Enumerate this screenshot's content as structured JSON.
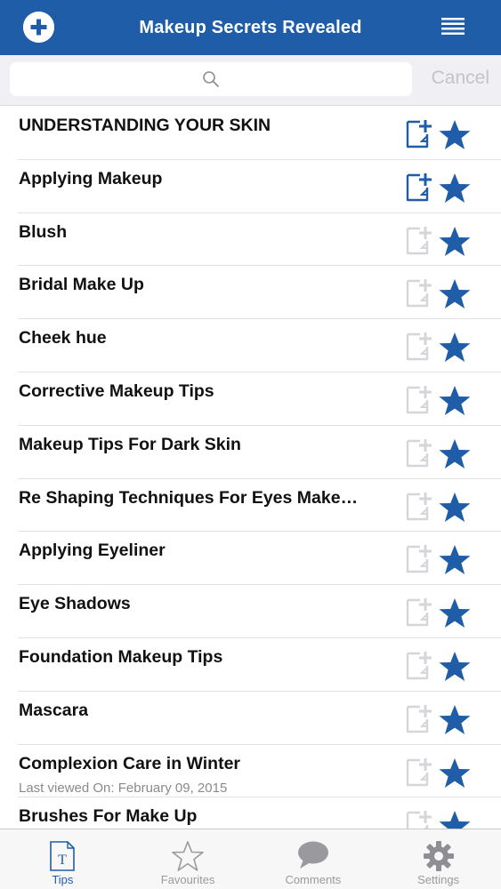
{
  "header": {
    "title": "Makeup Secrets Revealed",
    "add_icon": "plus-circle-icon",
    "menu_icon": "hamburger-menu-icon",
    "color": "#1f5da8"
  },
  "search": {
    "placeholder": "",
    "value": "",
    "icon": "search-icon",
    "cancel_label": "Cancel"
  },
  "list": {
    "items": [
      {
        "title": "UNDERSTANDING YOUR SKIN",
        "subtitle": "",
        "note_active": true
      },
      {
        "title": "Applying Makeup",
        "subtitle": "",
        "note_active": true
      },
      {
        "title": "Blush",
        "subtitle": "",
        "note_active": false
      },
      {
        "title": "Bridal Make Up",
        "subtitle": "",
        "note_active": false
      },
      {
        "title": "Cheek hue",
        "subtitle": "",
        "note_active": false
      },
      {
        "title": "Corrective Makeup Tips",
        "subtitle": "",
        "note_active": false
      },
      {
        "title": "Makeup Tips For Dark Skin",
        "subtitle": "",
        "note_active": false
      },
      {
        "title": "Re Shaping Techniques For Eyes Make…",
        "subtitle": "",
        "note_active": false
      },
      {
        "title": "Applying Eyeliner",
        "subtitle": "",
        "note_active": false
      },
      {
        "title": "Eye Shadows",
        "subtitle": "",
        "note_active": false
      },
      {
        "title": "Foundation Makeup Tips",
        "subtitle": "",
        "note_active": false
      },
      {
        "title": "Mascara",
        "subtitle": "",
        "note_active": false
      },
      {
        "title": "Complexion Care in Winter",
        "subtitle": "Last viewed On: February 09, 2015",
        "note_active": false
      },
      {
        "title": "Brushes For Make Up",
        "subtitle": "",
        "note_active": false
      }
    ],
    "note_icon": "add-note-icon",
    "star_icon": "star-icon",
    "star_color": "#1f5da8",
    "note_active_color": "#1f5da8",
    "note_inactive_color": "#d6d6da"
  },
  "tabbar": {
    "tabs": [
      {
        "label": "Tips",
        "icon": "document-icon",
        "active": true
      },
      {
        "label": "Favourites",
        "icon": "star-outline-icon",
        "active": false
      },
      {
        "label": "Comments",
        "icon": "speech-bubble-icon",
        "active": false
      },
      {
        "label": "Settings",
        "icon": "gear-icon",
        "active": false
      }
    ]
  }
}
